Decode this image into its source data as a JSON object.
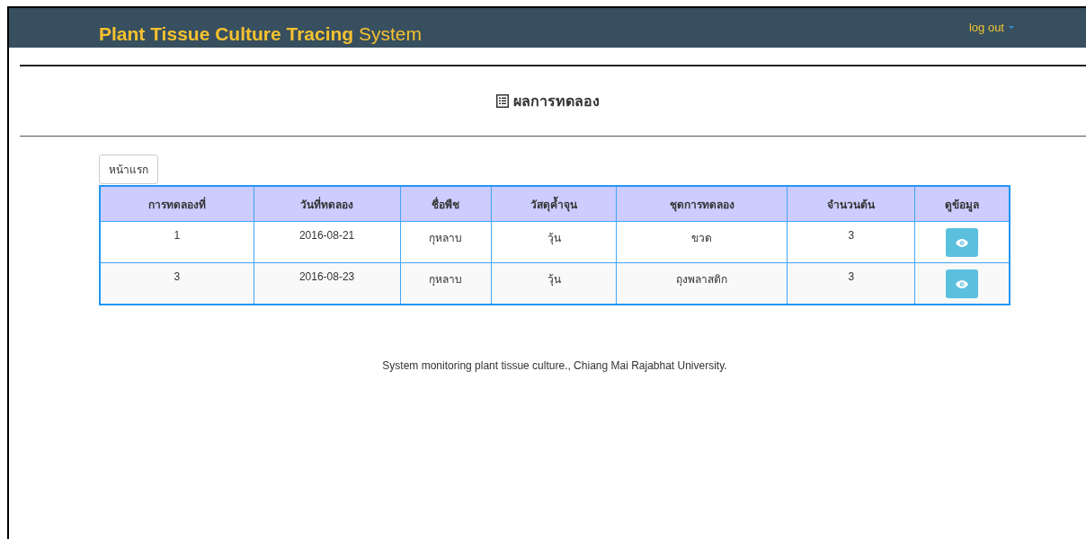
{
  "navbar": {
    "title": "**Plant Tissue Culture Tracing** System",
    "menu": "log out"
  },
  "heading": "ผลการทดลอง",
  "home_button": "หน้าแรก",
  "table": {
    "columns": [
      "การทดลองที่",
      "วันที่ทดลอง",
      "ชื่อพืช",
      "วัสดุค้ำจุน",
      "ชุดการทดลอง",
      "จำนวนต้น",
      "ดูข้อมูล"
    ],
    "rows": [
      {
        "cells": [
          "1",
          "2016-08-21",
          "กุหลาบ",
          "วุ้น",
          "ขวด",
          "3"
        ]
      },
      {
        "cells": [
          "3",
          "2016-08-23",
          "กุหลาบ",
          "วุ้น",
          "ถุงพลาสติก",
          "3"
        ]
      }
    ]
  },
  "footer": "System monitoring plant tissue culture., Chiang Mai Rajabhat University."
}
